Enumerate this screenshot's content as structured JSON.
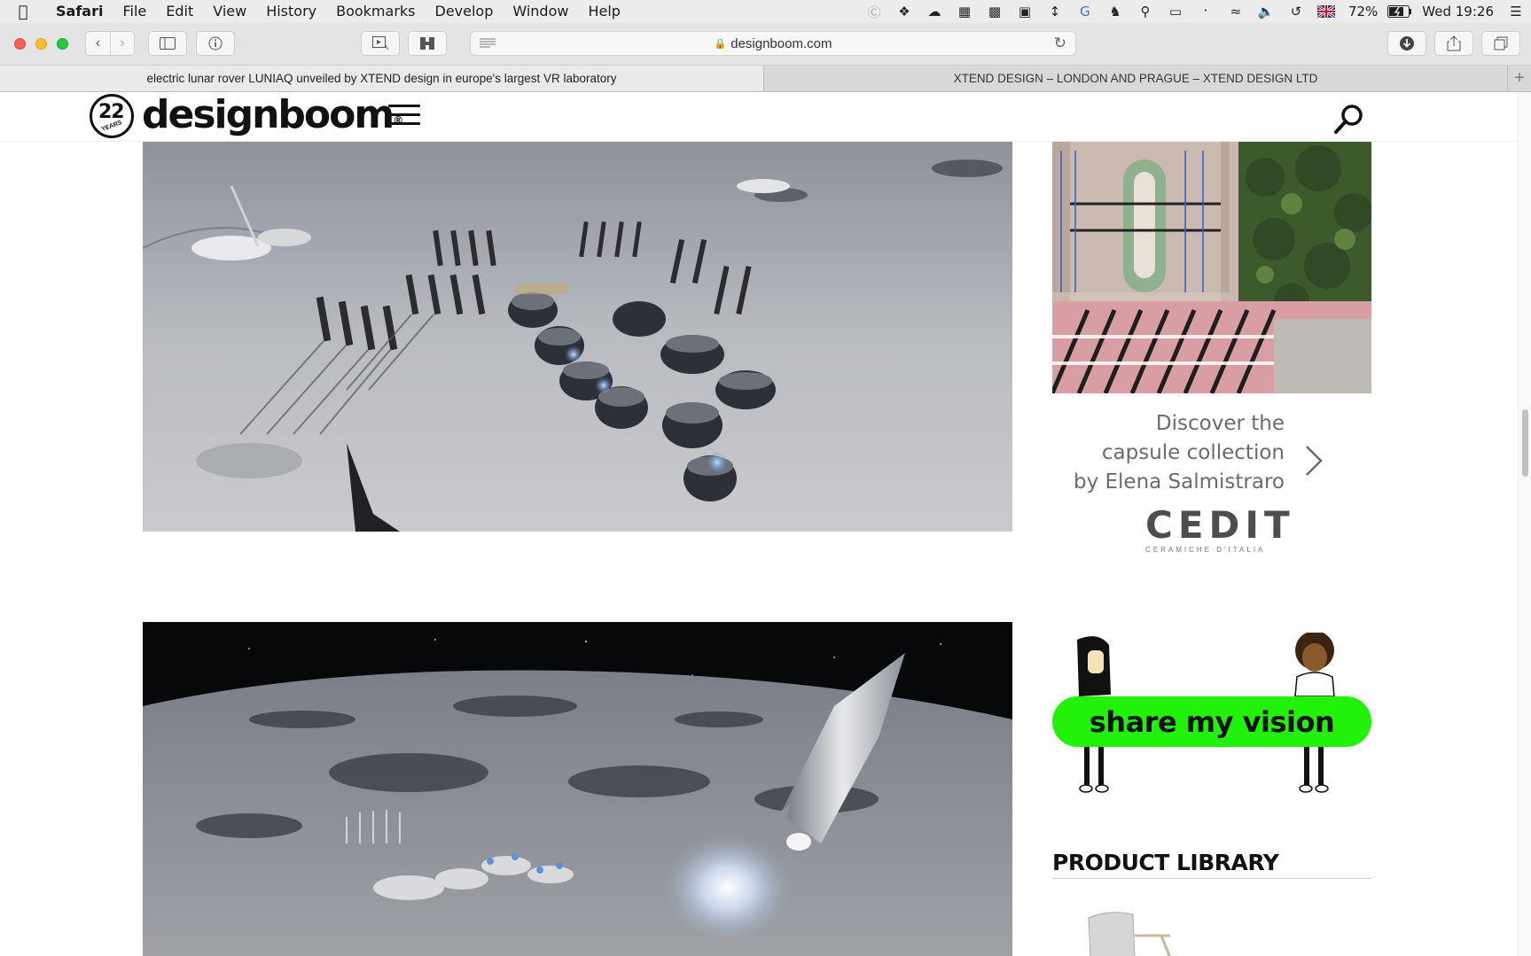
{
  "menubar": {
    "app": "Safari",
    "items": [
      "File",
      "Edit",
      "View",
      "History",
      "Bookmarks",
      "Develop",
      "Window",
      "Help"
    ],
    "battery": "72%",
    "clock": "Wed 19:26"
  },
  "toolbar": {
    "url": "designboom.com"
  },
  "tabs": [
    {
      "title": "electric lunar rover LUNIAQ unveiled by XTEND design in europe's largest VR laboratory"
    },
    {
      "title": "XTEND DESIGN – LONDON AND PRAGUE – XTEND DESIGN LTD"
    }
  ],
  "site": {
    "logo_badge": "22",
    "logo_badge_sub": "YEARS",
    "logo_text": "designboom",
    "logo_mark": "®"
  },
  "sidebar": {
    "ad_text": "Discover the capsule collection by Elena Salmistraro",
    "ad_brand": "CEDIT",
    "ad_brand_tagline": "CERAMICHE D'ITALIA",
    "share_label": "share my vision",
    "product_library_title": "PRODUCT LIBRARY"
  },
  "colors": {
    "share_green": "#22f10a",
    "toolbar_bg": "#e4e4e4"
  }
}
